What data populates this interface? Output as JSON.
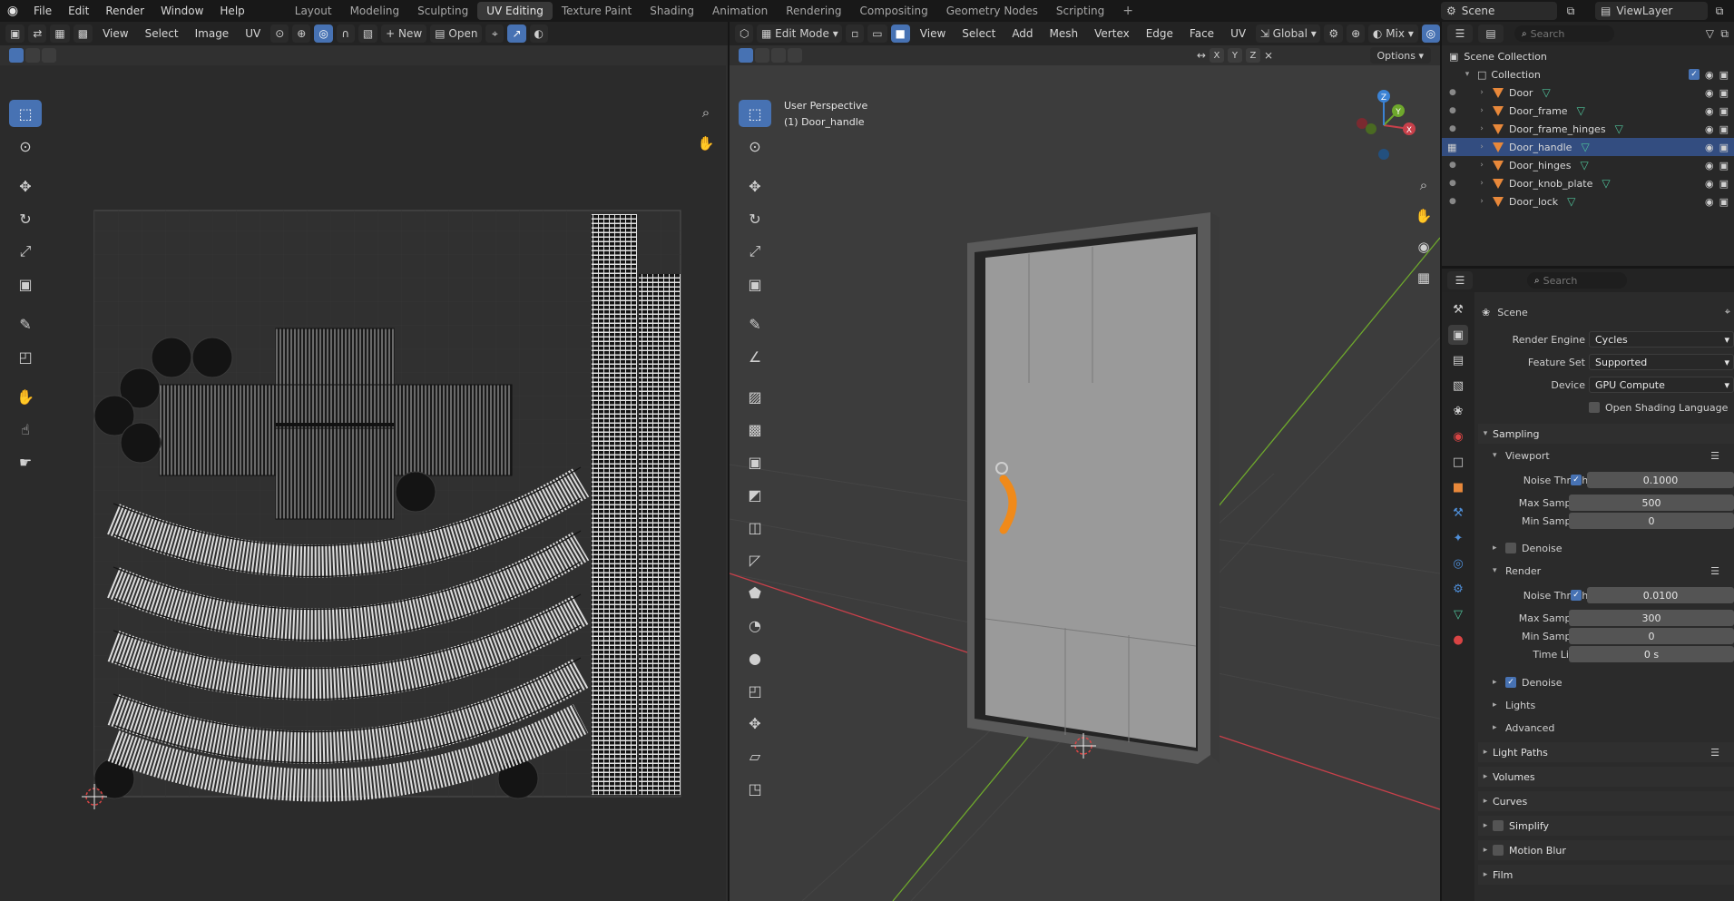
{
  "menu": {
    "items": [
      "File",
      "Edit",
      "Render",
      "Window",
      "Help"
    ]
  },
  "workspaces": {
    "tabs": [
      {
        "label": "Layout",
        "active": false
      },
      {
        "label": "Modeling",
        "active": false
      },
      {
        "label": "Sculpting",
        "active": false
      },
      {
        "label": "UV Editing",
        "active": true
      },
      {
        "label": "Texture Paint",
        "active": false
      },
      {
        "label": "Shading",
        "active": false
      },
      {
        "label": "Animation",
        "active": false
      },
      {
        "label": "Rendering",
        "active": false
      },
      {
        "label": "Compositing",
        "active": false
      },
      {
        "label": "Geometry Nodes",
        "active": false
      },
      {
        "label": "Scripting",
        "active": false
      }
    ],
    "add": "+"
  },
  "scene": {
    "name": "Scene"
  },
  "view_layer": {
    "name": "ViewLayer"
  },
  "uv_editor": {
    "menus": [
      "View",
      "Select",
      "Image",
      "UV"
    ],
    "new_label": "New",
    "open_label": "Open"
  },
  "viewport": {
    "mode": "Edit Mode",
    "menus": [
      "View",
      "Select",
      "Add",
      "Mesh",
      "Vertex",
      "Edge",
      "Face",
      "UV"
    ],
    "orientation": "Global",
    "shading": "Mix",
    "options_label": "Options",
    "axes": [
      "X",
      "Y",
      "Z"
    ],
    "perspective": "User Perspective",
    "object_label": "(1) Door_handle"
  },
  "outliner": {
    "search_placeholder": "Search",
    "scene_collection": "Scene Collection",
    "collection": "Collection",
    "objects": [
      {
        "name": "Door",
        "selected": false
      },
      {
        "name": "Door_frame",
        "selected": false
      },
      {
        "name": "Door_frame_hinges",
        "selected": false
      },
      {
        "name": "Door_handle",
        "selected": true
      },
      {
        "name": "Door_hinges",
        "selected": false
      },
      {
        "name": "Door_knob_plate",
        "selected": false
      },
      {
        "name": "Door_lock",
        "selected": false
      }
    ]
  },
  "properties": {
    "search_placeholder": "Search",
    "context": "Scene",
    "render_engine_label": "Render Engine",
    "render_engine": "Cycles",
    "feature_set_label": "Feature Set",
    "feature_set": "Supported",
    "device_label": "Device",
    "device": "GPU Compute",
    "osl_label": "Open Shading Language",
    "sampling": "Sampling",
    "viewport_panel": "Viewport",
    "noise_threshold_label": "Noise Threshold",
    "viewport_noise_threshold": "0.1000",
    "max_samples_label": "Max Samples",
    "viewport_max_samples": "500",
    "min_samples_label": "Min Samples",
    "viewport_min_samples": "0",
    "denoise_label": "Denoise",
    "render_panel": "Render",
    "render_noise_threshold": "0.0100",
    "render_max_samples": "300",
    "render_min_samples": "0",
    "time_limit_label": "Time Limit",
    "time_limit": "0 s",
    "lights": "Lights",
    "advanced": "Advanced",
    "light_paths": "Light Paths",
    "volumes": "Volumes",
    "curves": "Curves",
    "simplify": "Simplify",
    "motion_blur": "Motion Blur",
    "film": "Film"
  },
  "colors": {
    "accent": "#4772b3",
    "selected_object": "#e8883a",
    "x_axis": "#c8404a",
    "y_axis": "#6ea82c",
    "z_axis": "#3b82d4"
  }
}
